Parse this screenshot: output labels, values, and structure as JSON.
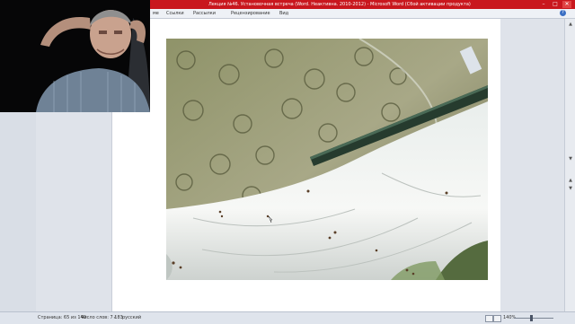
{
  "window": {
    "title": "Лекция №46. Установочная встреча (Word. Неактивна. 2010-2012) - Microsoft Word (Сбой активации продукта)",
    "buttons": [
      "–",
      "□",
      "✕"
    ]
  },
  "ribbon": {
    "tabs": [
      "ме",
      "Ссылки",
      "Рассылки",
      "Рецензирование",
      "Вид"
    ]
  },
  "statusbar": {
    "page": "Страница: 65 из 140",
    "words": "Число слов: 7 183",
    "language": "русский",
    "zoom": "140%",
    "zoom_level": 0.45
  },
  "icons": {
    "help": "help-icon",
    "scroll_up": "scroll-up-icon",
    "scroll_down": "scroll-down-icon",
    "page_up": "page-up-icon",
    "page_down": "page-down-icon",
    "spellcheck": "spellcheck-icon"
  },
  "colors": {
    "titlebar": "#c9171e",
    "page": "#ffffff",
    "background": "#d9dee6"
  }
}
